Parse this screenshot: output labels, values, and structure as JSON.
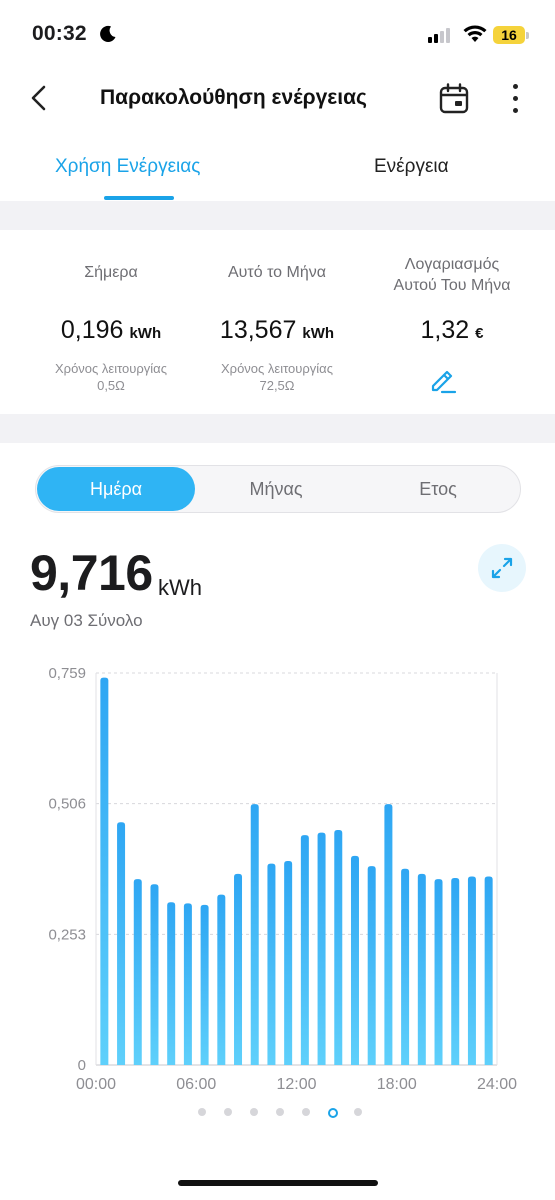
{
  "status_bar": {
    "time": "00:32",
    "battery": "16"
  },
  "header": {
    "title": "Παρακολούθηση ενέργειας"
  },
  "tabs": [
    {
      "label": "Χρήση Ενέργειας",
      "active": true
    },
    {
      "label": "Ενέργεια",
      "active": false
    }
  ],
  "summary": {
    "today": {
      "label": "Σήμερα",
      "value": "0,196",
      "unit": "kWh",
      "runtime_label": "Χρόνος λειτουργίας",
      "runtime": "0,5Ω"
    },
    "month": {
      "label": "Αυτό το Μήνα",
      "value": "13,567",
      "unit": "kWh",
      "runtime_label": "Χρόνος λειτουργίας",
      "runtime": "72,5Ω"
    },
    "bill": {
      "label_line1": "Λογαριασμός",
      "label_line2": "Αυτού Του Μήνα",
      "value": "1,32",
      "unit": "€"
    }
  },
  "period_selector": {
    "options": [
      "Ημέρα",
      "Μήνας",
      "Ετος"
    ],
    "selected": "Ημέρα"
  },
  "total": {
    "value": "9,716",
    "unit": "kWh",
    "label": "Αυγ 03 Σύνολο"
  },
  "colors": {
    "accent": "#1aa3e8",
    "bar_top": "#2ea6f3",
    "bar_bottom": "#5fd0fb"
  },
  "pager": {
    "count": 7,
    "active": 5
  },
  "chart_data": {
    "type": "bar",
    "categories": [
      "00:00",
      "01:00",
      "02:00",
      "03:00",
      "04:00",
      "05:00",
      "06:00",
      "07:00",
      "08:00",
      "09:00",
      "10:00",
      "11:00",
      "12:00",
      "13:00",
      "14:00",
      "15:00",
      "16:00",
      "17:00",
      "18:00",
      "19:00",
      "20:00",
      "21:00",
      "22:00",
      "23:00"
    ],
    "values": [
      0.75,
      0.47,
      0.36,
      0.35,
      0.315,
      0.313,
      0.31,
      0.33,
      0.37,
      0.505,
      0.39,
      0.395,
      0.445,
      0.45,
      0.455,
      0.405,
      0.385,
      0.505,
      0.38,
      0.37,
      0.36,
      0.362,
      0.365,
      0.365
    ],
    "y_ticks": [
      "0,759",
      "0,506",
      "0,253",
      "0"
    ],
    "y_tick_values": [
      0.759,
      0.506,
      0.253,
      0
    ],
    "x_ticks": [
      "00:00",
      "06:00",
      "12:00",
      "18:00",
      "24:00"
    ],
    "ylim": [
      0,
      0.759
    ],
    "grid": true
  }
}
